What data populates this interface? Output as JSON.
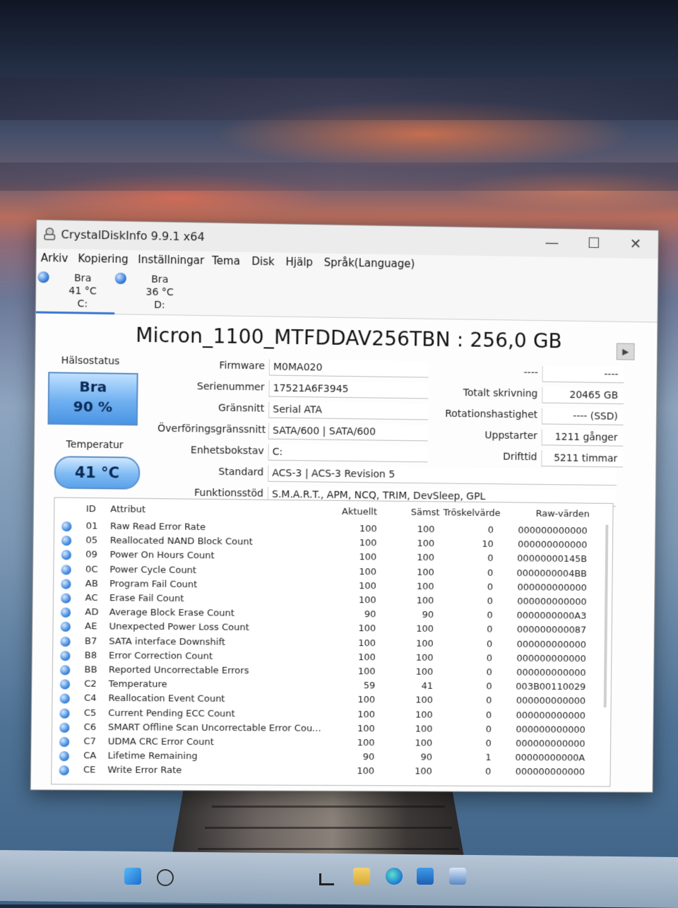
{
  "window": {
    "title": "CrystalDiskInfo 9.9.1 x64",
    "controls": {
      "minimize": "—",
      "maximize": "☐",
      "close": "✕"
    }
  },
  "menu": [
    "Arkiv",
    "Kopiering",
    "Inställningar",
    "Tema",
    "Disk",
    "Hjälp",
    "Språk(Language)"
  ],
  "drives": [
    {
      "status": "Bra",
      "temp": "41 °C",
      "letter": "C:"
    },
    {
      "status": "Bra",
      "temp": "36 °C",
      "letter": "D:"
    }
  ],
  "disk": {
    "model": "Micron_1100_MTFDDAV256TBN : 256,0 GB",
    "health_label": "Hälsostatus",
    "health_status": "Bra",
    "health_percent": "90 %",
    "temp_label": "Temperatur",
    "temperature": "41 °C"
  },
  "fields": [
    {
      "label": "Firmware",
      "value": "M0MA020"
    },
    {
      "label": "Serienummer",
      "value": "17521A6F3945"
    },
    {
      "label": "Gränsnitt",
      "value": "Serial ATA"
    },
    {
      "label": "Överföringsgränssnitt",
      "value": "SATA/600 | SATA/600"
    },
    {
      "label": "Enhetsbokstav",
      "value": "C:"
    },
    {
      "label": "Standard",
      "value": "ACS-3 | ACS-3 Revision 5"
    },
    {
      "label": "Funktionsstöd",
      "value": "S.M.A.R.T., APM, NCQ, TRIM, DevSleep, GPL"
    }
  ],
  "right_fields": [
    {
      "label": "----",
      "value": "----"
    },
    {
      "label": "Totalt skrivning",
      "value": "20465 GB"
    },
    {
      "label": "Rotationshastighet",
      "value": "---- (SSD)"
    },
    {
      "label": "Uppstarter",
      "value": "1211 gånger"
    },
    {
      "label": "Drifttid",
      "value": "5211 timmar"
    }
  ],
  "smart": {
    "headers": {
      "id": "ID",
      "attr": "Attribut",
      "current": "Aktuellt",
      "worst": "Sämst",
      "threshold": "Tröskelvärde",
      "raw": "Raw-värden"
    },
    "rows": [
      {
        "id": "01",
        "attr": "Raw Read Error Rate",
        "current": "100",
        "worst": "100",
        "threshold": "0",
        "raw": "000000000000"
      },
      {
        "id": "05",
        "attr": "Reallocated NAND Block Count",
        "current": "100",
        "worst": "100",
        "threshold": "10",
        "raw": "000000000000"
      },
      {
        "id": "09",
        "attr": "Power On Hours Count",
        "current": "100",
        "worst": "100",
        "threshold": "0",
        "raw": "00000000145B"
      },
      {
        "id": "0C",
        "attr": "Power Cycle Count",
        "current": "100",
        "worst": "100",
        "threshold": "0",
        "raw": "0000000004BB"
      },
      {
        "id": "AB",
        "attr": "Program Fail Count",
        "current": "100",
        "worst": "100",
        "threshold": "0",
        "raw": "000000000000"
      },
      {
        "id": "AC",
        "attr": "Erase Fail Count",
        "current": "100",
        "worst": "100",
        "threshold": "0",
        "raw": "000000000000"
      },
      {
        "id": "AD",
        "attr": "Average Block Erase Count",
        "current": "90",
        "worst": "90",
        "threshold": "0",
        "raw": "0000000000A3"
      },
      {
        "id": "AE",
        "attr": "Unexpected Power Loss Count",
        "current": "100",
        "worst": "100",
        "threshold": "0",
        "raw": "000000000087"
      },
      {
        "id": "B7",
        "attr": "SATA interface Downshift",
        "current": "100",
        "worst": "100",
        "threshold": "0",
        "raw": "000000000000"
      },
      {
        "id": "B8",
        "attr": "Error Correction Count",
        "current": "100",
        "worst": "100",
        "threshold": "0",
        "raw": "000000000000"
      },
      {
        "id": "BB",
        "attr": "Reported Uncorrectable Errors",
        "current": "100",
        "worst": "100",
        "threshold": "0",
        "raw": "000000000000"
      },
      {
        "id": "C2",
        "attr": "Temperature",
        "current": "59",
        "worst": "41",
        "threshold": "0",
        "raw": "003B00110029"
      },
      {
        "id": "C4",
        "attr": "Reallocation Event Count",
        "current": "100",
        "worst": "100",
        "threshold": "0",
        "raw": "000000000000"
      },
      {
        "id": "C5",
        "attr": "Current Pending ECC Count",
        "current": "100",
        "worst": "100",
        "threshold": "0",
        "raw": "000000000000"
      },
      {
        "id": "C6",
        "attr": "SMART Offline Scan Uncorrectable Error Cou...",
        "current": "100",
        "worst": "100",
        "threshold": "0",
        "raw": "000000000000"
      },
      {
        "id": "C7",
        "attr": "UDMA CRC Error Count",
        "current": "100",
        "worst": "100",
        "threshold": "0",
        "raw": "000000000000"
      },
      {
        "id": "CA",
        "attr": "Lifetime Remaining",
        "current": "90",
        "worst": "90",
        "threshold": "1",
        "raw": "00000000000A"
      },
      {
        "id": "CE",
        "attr": "Write Error Rate",
        "current": "100",
        "worst": "100",
        "threshold": "0",
        "raw": "000000000000"
      }
    ]
  }
}
